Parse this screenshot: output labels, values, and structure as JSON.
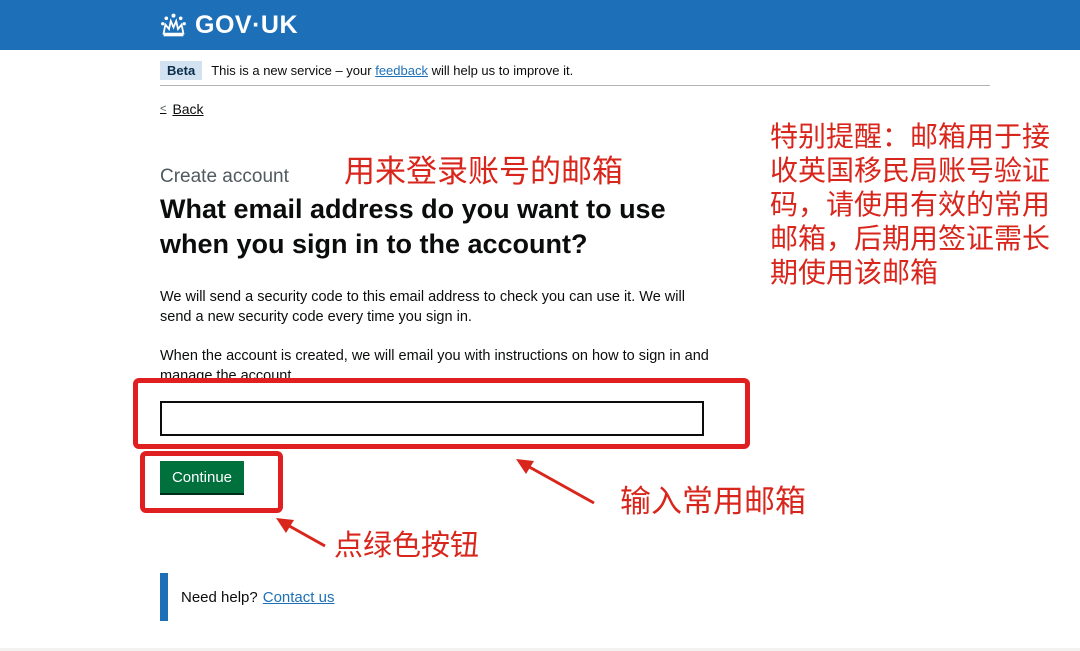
{
  "header": {
    "logotype": "GOV·UK",
    "logo_icon": "crown-icon",
    "color": "#1d70b8"
  },
  "phase_banner": {
    "tag": "Beta",
    "text_before": "This is a new service – your ",
    "link": "feedback",
    "text_after": " will help us to improve it."
  },
  "nav": {
    "back_label": "Back"
  },
  "main": {
    "caption": "Create account",
    "heading": "What email address do you want to use when you sign in to the account?",
    "para_1": "We will send a security code to this email address to check you can use it. We will send a new security code every time you sign in.",
    "para_2": "When the account is created, we will email you with instructions on how to sign in and manage the account.",
    "email_value": "",
    "continue_label": "Continue",
    "button_color": "#00703c"
  },
  "help": {
    "text": "Need help?",
    "link": "Contact us"
  },
  "annotations": {
    "login_email": "用来登录账号的邮箱",
    "enter_email": "输入常用邮箱",
    "click_button": "点绿色按钮",
    "note": "特别提醒：邮箱用于接收英国移民局账号验证码，请使用有效的常用邮箱，后期用签证需长期使用该邮箱",
    "color": "#d9261c"
  }
}
